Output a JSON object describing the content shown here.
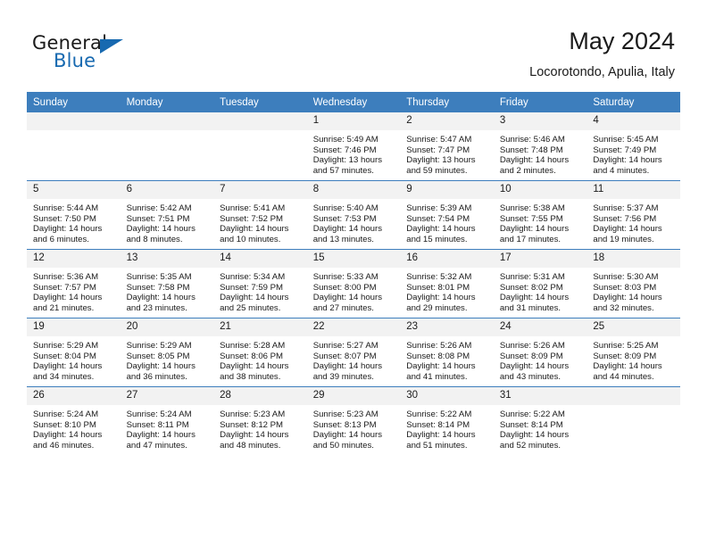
{
  "brand": {
    "name_top": "General",
    "name_bottom": "Blue",
    "accent_color": "#1769b0"
  },
  "header": {
    "title": "May 2024",
    "location": "Locorotondo, Apulia, Italy"
  },
  "theme": {
    "header_row_color": "#3d7ebd",
    "daynum_band_color": "#f2f2f2",
    "text_color": "#1a1a1a"
  },
  "calendar": {
    "weekday_headers": [
      "Sunday",
      "Monday",
      "Tuesday",
      "Wednesday",
      "Thursday",
      "Friday",
      "Saturday"
    ],
    "labels": {
      "sunrise": "Sunrise:",
      "sunset": "Sunset:",
      "daylight": "Daylight:"
    },
    "weeks": [
      [
        {
          "day": "",
          "empty": true
        },
        {
          "day": "",
          "empty": true
        },
        {
          "day": "",
          "empty": true
        },
        {
          "day": "1",
          "sunrise": "Sunrise: 5:49 AM",
          "sunset": "Sunset: 7:46 PM",
          "daylight_1": "Daylight: 13 hours",
          "daylight_2": "and 57 minutes."
        },
        {
          "day": "2",
          "sunrise": "Sunrise: 5:47 AM",
          "sunset": "Sunset: 7:47 PM",
          "daylight_1": "Daylight: 13 hours",
          "daylight_2": "and 59 minutes."
        },
        {
          "day": "3",
          "sunrise": "Sunrise: 5:46 AM",
          "sunset": "Sunset: 7:48 PM",
          "daylight_1": "Daylight: 14 hours",
          "daylight_2": "and 2 minutes."
        },
        {
          "day": "4",
          "sunrise": "Sunrise: 5:45 AM",
          "sunset": "Sunset: 7:49 PM",
          "daylight_1": "Daylight: 14 hours",
          "daylight_2": "and 4 minutes."
        }
      ],
      [
        {
          "day": "5",
          "sunrise": "Sunrise: 5:44 AM",
          "sunset": "Sunset: 7:50 PM",
          "daylight_1": "Daylight: 14 hours",
          "daylight_2": "and 6 minutes."
        },
        {
          "day": "6",
          "sunrise": "Sunrise: 5:42 AM",
          "sunset": "Sunset: 7:51 PM",
          "daylight_1": "Daylight: 14 hours",
          "daylight_2": "and 8 minutes."
        },
        {
          "day": "7",
          "sunrise": "Sunrise: 5:41 AM",
          "sunset": "Sunset: 7:52 PM",
          "daylight_1": "Daylight: 14 hours",
          "daylight_2": "and 10 minutes."
        },
        {
          "day": "8",
          "sunrise": "Sunrise: 5:40 AM",
          "sunset": "Sunset: 7:53 PM",
          "daylight_1": "Daylight: 14 hours",
          "daylight_2": "and 13 minutes."
        },
        {
          "day": "9",
          "sunrise": "Sunrise: 5:39 AM",
          "sunset": "Sunset: 7:54 PM",
          "daylight_1": "Daylight: 14 hours",
          "daylight_2": "and 15 minutes."
        },
        {
          "day": "10",
          "sunrise": "Sunrise: 5:38 AM",
          "sunset": "Sunset: 7:55 PM",
          "daylight_1": "Daylight: 14 hours",
          "daylight_2": "and 17 minutes."
        },
        {
          "day": "11",
          "sunrise": "Sunrise: 5:37 AM",
          "sunset": "Sunset: 7:56 PM",
          "daylight_1": "Daylight: 14 hours",
          "daylight_2": "and 19 minutes."
        }
      ],
      [
        {
          "day": "12",
          "sunrise": "Sunrise: 5:36 AM",
          "sunset": "Sunset: 7:57 PM",
          "daylight_1": "Daylight: 14 hours",
          "daylight_2": "and 21 minutes."
        },
        {
          "day": "13",
          "sunrise": "Sunrise: 5:35 AM",
          "sunset": "Sunset: 7:58 PM",
          "daylight_1": "Daylight: 14 hours",
          "daylight_2": "and 23 minutes."
        },
        {
          "day": "14",
          "sunrise": "Sunrise: 5:34 AM",
          "sunset": "Sunset: 7:59 PM",
          "daylight_1": "Daylight: 14 hours",
          "daylight_2": "and 25 minutes."
        },
        {
          "day": "15",
          "sunrise": "Sunrise: 5:33 AM",
          "sunset": "Sunset: 8:00 PM",
          "daylight_1": "Daylight: 14 hours",
          "daylight_2": "and 27 minutes."
        },
        {
          "day": "16",
          "sunrise": "Sunrise: 5:32 AM",
          "sunset": "Sunset: 8:01 PM",
          "daylight_1": "Daylight: 14 hours",
          "daylight_2": "and 29 minutes."
        },
        {
          "day": "17",
          "sunrise": "Sunrise: 5:31 AM",
          "sunset": "Sunset: 8:02 PM",
          "daylight_1": "Daylight: 14 hours",
          "daylight_2": "and 31 minutes."
        },
        {
          "day": "18",
          "sunrise": "Sunrise: 5:30 AM",
          "sunset": "Sunset: 8:03 PM",
          "daylight_1": "Daylight: 14 hours",
          "daylight_2": "and 32 minutes."
        }
      ],
      [
        {
          "day": "19",
          "sunrise": "Sunrise: 5:29 AM",
          "sunset": "Sunset: 8:04 PM",
          "daylight_1": "Daylight: 14 hours",
          "daylight_2": "and 34 minutes."
        },
        {
          "day": "20",
          "sunrise": "Sunrise: 5:29 AM",
          "sunset": "Sunset: 8:05 PM",
          "daylight_1": "Daylight: 14 hours",
          "daylight_2": "and 36 minutes."
        },
        {
          "day": "21",
          "sunrise": "Sunrise: 5:28 AM",
          "sunset": "Sunset: 8:06 PM",
          "daylight_1": "Daylight: 14 hours",
          "daylight_2": "and 38 minutes."
        },
        {
          "day": "22",
          "sunrise": "Sunrise: 5:27 AM",
          "sunset": "Sunset: 8:07 PM",
          "daylight_1": "Daylight: 14 hours",
          "daylight_2": "and 39 minutes."
        },
        {
          "day": "23",
          "sunrise": "Sunrise: 5:26 AM",
          "sunset": "Sunset: 8:08 PM",
          "daylight_1": "Daylight: 14 hours",
          "daylight_2": "and 41 minutes."
        },
        {
          "day": "24",
          "sunrise": "Sunrise: 5:26 AM",
          "sunset": "Sunset: 8:09 PM",
          "daylight_1": "Daylight: 14 hours",
          "daylight_2": "and 43 minutes."
        },
        {
          "day": "25",
          "sunrise": "Sunrise: 5:25 AM",
          "sunset": "Sunset: 8:09 PM",
          "daylight_1": "Daylight: 14 hours",
          "daylight_2": "and 44 minutes."
        }
      ],
      [
        {
          "day": "26",
          "sunrise": "Sunrise: 5:24 AM",
          "sunset": "Sunset: 8:10 PM",
          "daylight_1": "Daylight: 14 hours",
          "daylight_2": "and 46 minutes."
        },
        {
          "day": "27",
          "sunrise": "Sunrise: 5:24 AM",
          "sunset": "Sunset: 8:11 PM",
          "daylight_1": "Daylight: 14 hours",
          "daylight_2": "and 47 minutes."
        },
        {
          "day": "28",
          "sunrise": "Sunrise: 5:23 AM",
          "sunset": "Sunset: 8:12 PM",
          "daylight_1": "Daylight: 14 hours",
          "daylight_2": "and 48 minutes."
        },
        {
          "day": "29",
          "sunrise": "Sunrise: 5:23 AM",
          "sunset": "Sunset: 8:13 PM",
          "daylight_1": "Daylight: 14 hours",
          "daylight_2": "and 50 minutes."
        },
        {
          "day": "30",
          "sunrise": "Sunrise: 5:22 AM",
          "sunset": "Sunset: 8:14 PM",
          "daylight_1": "Daylight: 14 hours",
          "daylight_2": "and 51 minutes."
        },
        {
          "day": "31",
          "sunrise": "Sunrise: 5:22 AM",
          "sunset": "Sunset: 8:14 PM",
          "daylight_1": "Daylight: 14 hours",
          "daylight_2": "and 52 minutes."
        },
        {
          "day": "",
          "empty": true
        }
      ]
    ]
  }
}
